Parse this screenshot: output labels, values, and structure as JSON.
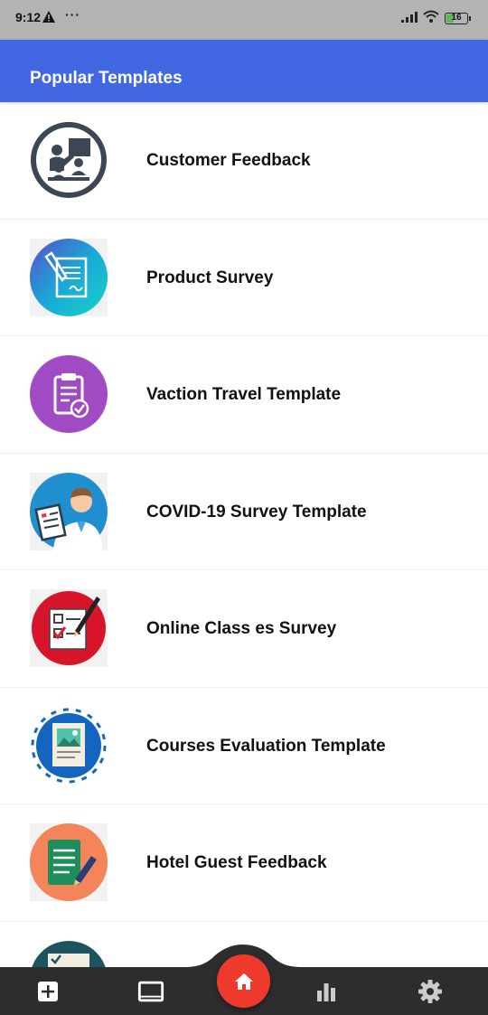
{
  "status_bar": {
    "time": "9:12",
    "dots": "···",
    "battery": "16",
    "icons": [
      "alert-icon",
      "signal-icon",
      "wifi-icon",
      "battery-icon"
    ]
  },
  "app_bar": {
    "title": "Popular Templates"
  },
  "templates": [
    {
      "label": "Customer Feedback",
      "icon": "presentation-icon"
    },
    {
      "label": "Product Survey",
      "icon": "document-sign-icon"
    },
    {
      "label": "Vaction Travel Template",
      "icon": "clipboard-check-icon"
    },
    {
      "label": "COVID-19 Survey Template",
      "icon": "doctor-icon"
    },
    {
      "label": "Online Class es Survey",
      "icon": "checklist-pen-icon"
    },
    {
      "label": "Courses Evaluation Template",
      "icon": "image-document-icon"
    },
    {
      "label": "Hotel Guest Feedback",
      "icon": "notepad-pen-icon"
    },
    {
      "label": "",
      "icon": "checklist-icon"
    }
  ],
  "bottom_nav": {
    "items": [
      "add-icon",
      "tablet-icon",
      "home-icon",
      "bar-chart-icon",
      "settings-icon"
    ]
  },
  "colors": {
    "accent": "#4168e2",
    "fab": "#ee3a2c",
    "nav_bg": "#2d2d30",
    "status_bg": "#b3b3b3"
  }
}
